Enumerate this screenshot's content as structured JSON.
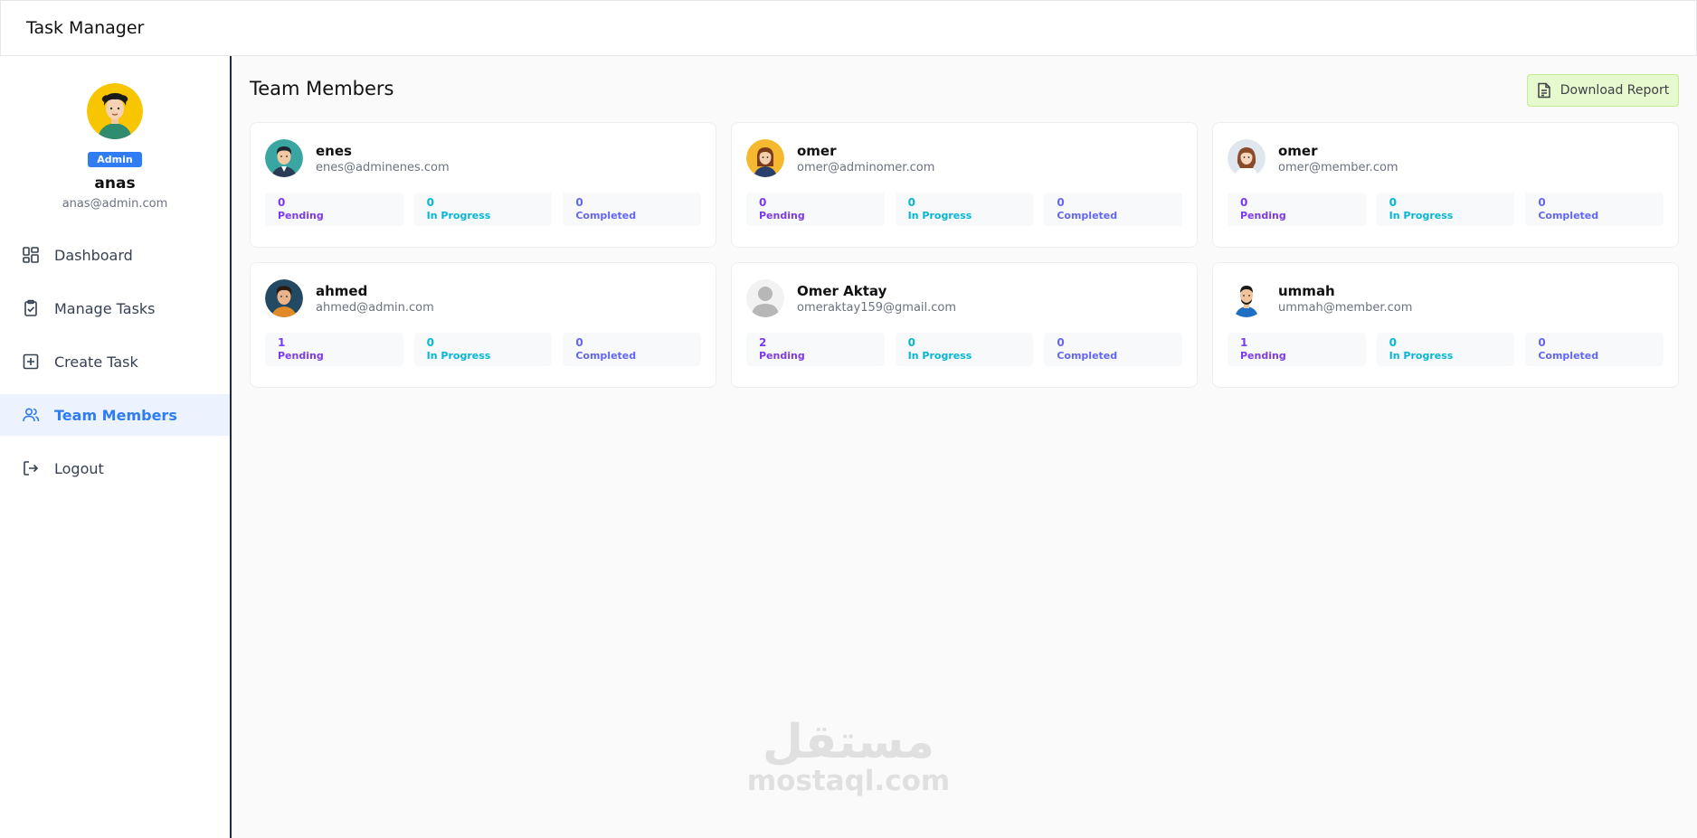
{
  "app": {
    "title": "Task Manager"
  },
  "profile": {
    "role": "Admin",
    "name": "anas",
    "email": "anas@admin.com"
  },
  "nav": {
    "dashboard": "Dashboard",
    "manage_tasks": "Manage Tasks",
    "create_task": "Create Task",
    "team_members": "Team Members",
    "logout": "Logout"
  },
  "page": {
    "title": "Team Members",
    "download_label": "Download Report"
  },
  "stat_labels": {
    "pending": "Pending",
    "in_progress": "In Progress",
    "completed": "Completed"
  },
  "members": [
    {
      "name": "enes",
      "email": "enes@adminenes.com",
      "pending": "0",
      "in_progress": "0",
      "completed": "0"
    },
    {
      "name": "omer",
      "email": "omer@adminomer.com",
      "pending": "0",
      "in_progress": "0",
      "completed": "0"
    },
    {
      "name": "omer",
      "email": "omer@member.com",
      "pending": "0",
      "in_progress": "0",
      "completed": "0"
    },
    {
      "name": "ahmed",
      "email": "ahmed@admin.com",
      "pending": "1",
      "in_progress": "0",
      "completed": "0"
    },
    {
      "name": "Omer Aktay",
      "email": "omeraktay159@gmail.com",
      "pending": "2",
      "in_progress": "0",
      "completed": "0"
    },
    {
      "name": "ummah",
      "email": "ummah@member.com",
      "pending": "1",
      "in_progress": "0",
      "completed": "0"
    }
  ],
  "watermark": {
    "arabic": "مستقل",
    "latin": "mostaql.com"
  },
  "colors": {
    "accent": "#2f7cf3",
    "pending": "#7c3aed",
    "in_progress": "#06b6d4",
    "completed": "#6366f1",
    "download_bg": "#e6f9cf"
  },
  "icons": {
    "dashboard": "dashboard-grid-icon",
    "manage_tasks": "clipboard-check-icon",
    "create_task": "plus-square-icon",
    "team_members": "users-icon",
    "logout": "logout-icon",
    "download": "file-text-icon"
  }
}
